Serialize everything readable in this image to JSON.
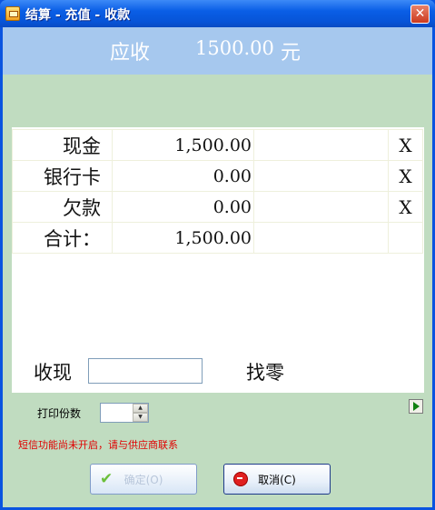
{
  "window": {
    "title": "结算 - 充值 - 收款",
    "close_label": "✕"
  },
  "amount_due": {
    "label": "应收",
    "value": "1500.00",
    "unit": "元"
  },
  "payments": [
    {
      "method": "现金",
      "amount": "1,500.00",
      "delete": "X"
    },
    {
      "method": "银行卡",
      "amount": "0.00",
      "delete": "X"
    },
    {
      "method": "欠款",
      "amount": "0.00",
      "delete": "X"
    }
  ],
  "total": {
    "label": "合计：",
    "amount": "1,500.00"
  },
  "receive": {
    "label": "收现",
    "value": ""
  },
  "change": {
    "label": "找零"
  },
  "print": {
    "label": "打印份数",
    "value": ""
  },
  "sms_message": "短信功能尚未开启，请与供应商联系",
  "buttons": {
    "ok_label": "确定(O)",
    "cancel_label": "取消(C)"
  },
  "colors": {
    "client_bg": "#c0dcc0",
    "amount_band": "#a6c8ee",
    "title_bar": "#0a5ee6",
    "warning_text": "#e00000"
  },
  "icons": {
    "app": "app-folder-icon",
    "close": "close-icon",
    "ok": "check-icon",
    "cancel": "stop-icon",
    "side": "arrow-right-icon"
  }
}
